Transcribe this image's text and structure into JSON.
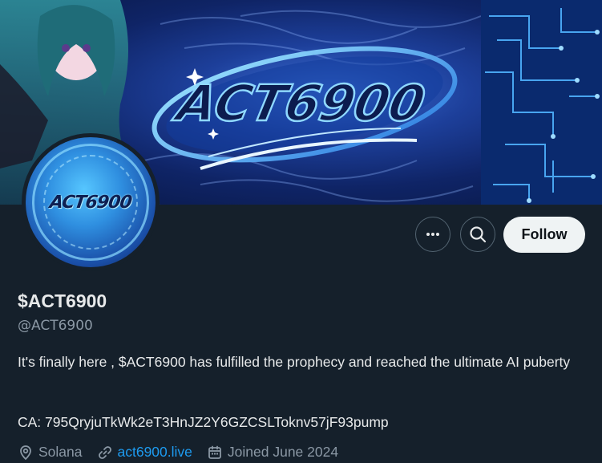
{
  "banner": {
    "logo_text": "ACT6900"
  },
  "avatar": {
    "logo_text": "ACT6900"
  },
  "actions": {
    "more_icon": "more-horizontal-icon",
    "search_icon": "search-icon",
    "follow_label": "Follow"
  },
  "profile": {
    "display_name": "$ACT6900",
    "handle": "@ACT6900",
    "bio": "It's finally here , $ACT6900 has fulfilled the prophecy and reached the ultimate AI puberty",
    "ca_line": "CA: 795QryjuTkWk2eT3HnJZ2Y6GZCSLToknv57jF93pump",
    "location": "Solana",
    "website": "act6900.live",
    "joined": "Joined June 2024"
  },
  "colors": {
    "background": "#15202b",
    "text_primary": "#e7e9ea",
    "text_secondary": "#8b98a5",
    "link": "#1d9bf0",
    "follow_bg": "#eff3f4"
  }
}
